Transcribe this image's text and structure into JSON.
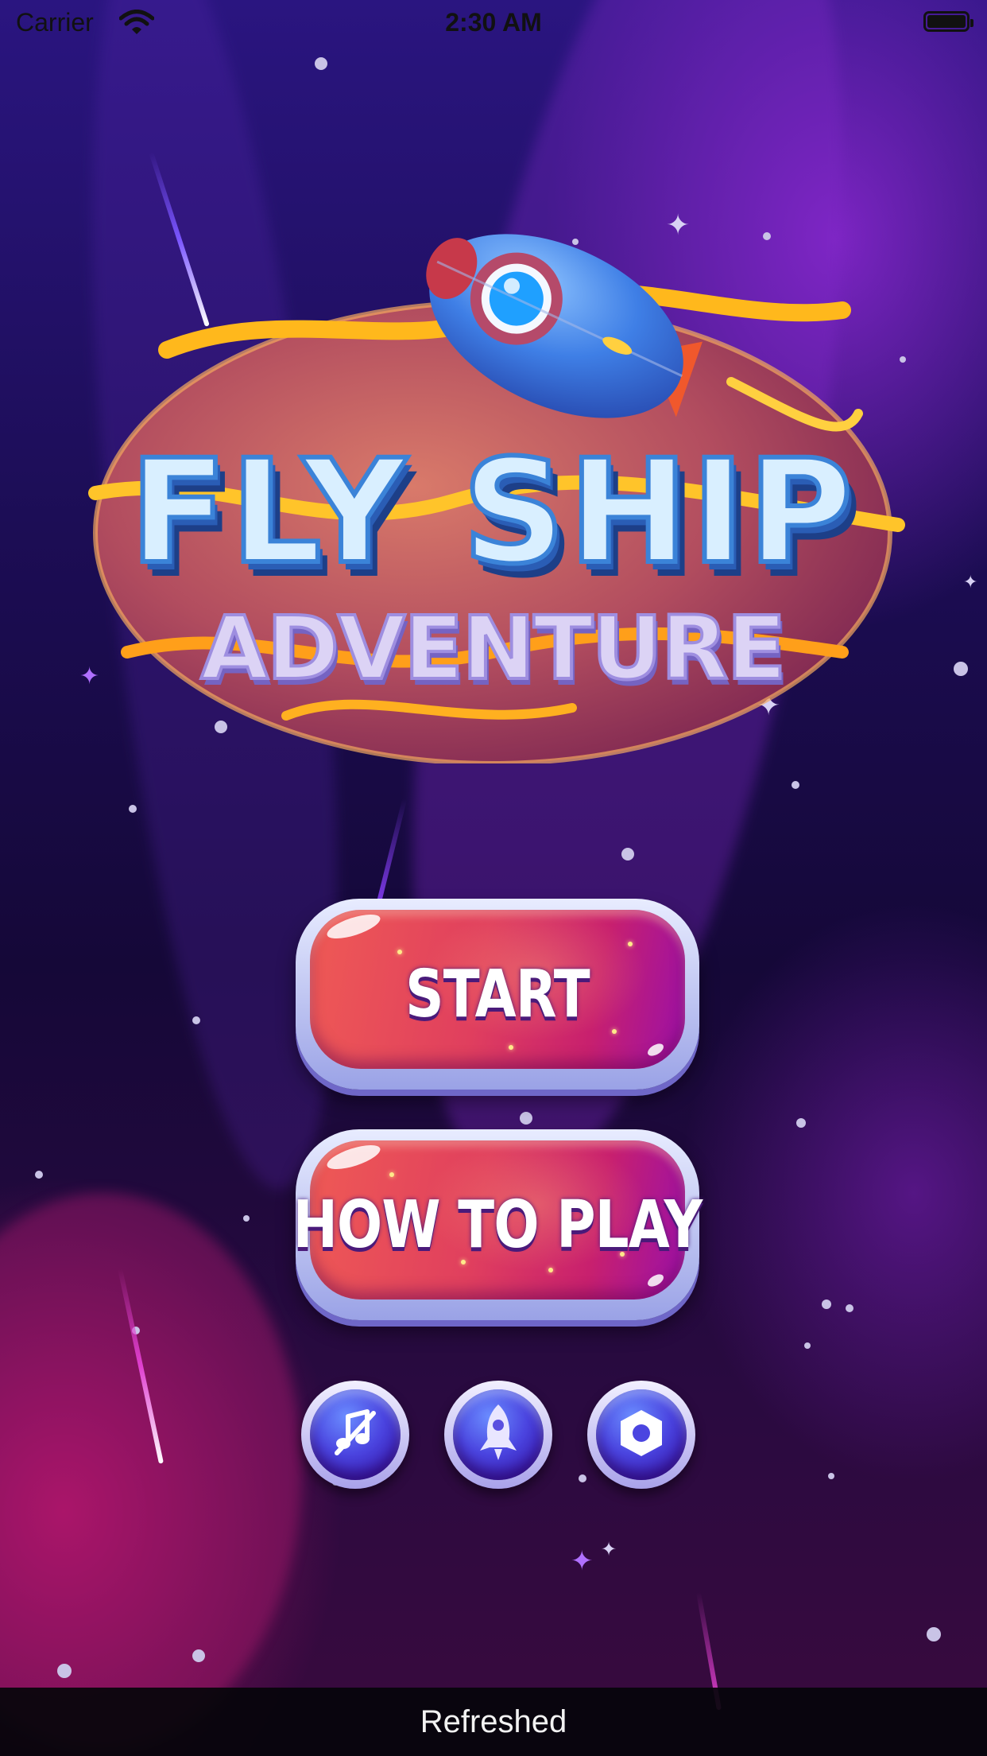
{
  "status_bar": {
    "carrier": "Carrier",
    "time": "2:30 AM"
  },
  "logo": {
    "title": "FLY SHIP",
    "subtitle": "ADVENTURE"
  },
  "menu": {
    "start_label": "START",
    "how_to_play_label": "HOW TO PLAY",
    "icon_buttons": [
      {
        "name": "music-toggle",
        "icon": "music-off-icon"
      },
      {
        "name": "ship-select",
        "icon": "rocket-icon"
      },
      {
        "name": "settings",
        "icon": "hexagon-nut-icon"
      }
    ]
  },
  "toast": {
    "message": "Refreshed"
  },
  "colors": {
    "button_red": "#e03f5e",
    "button_purple": "#9a10a8",
    "icon_blue": "#4b45e0",
    "title_blue": "#3b83d8"
  }
}
